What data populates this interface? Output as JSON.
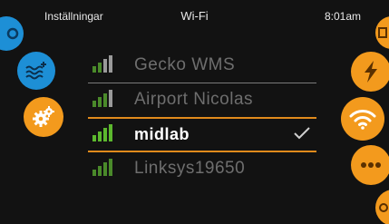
{
  "topbar": {
    "left": "Inställningar",
    "title": "Wi-Fi",
    "time": "8:01am"
  },
  "colors": {
    "accent": "#f39a1d",
    "signal": "#5cb82e",
    "water": "#1d8fd6",
    "background": "#121212"
  },
  "left_menu": [
    {
      "icon": "settings-icon-partial",
      "selected": false
    },
    {
      "icon": "water-heat-icon",
      "selected": false
    },
    {
      "icon": "gears-icon",
      "selected": true
    }
  ],
  "right_menu": [
    {
      "icon": "top-partial-icon",
      "selected": false
    },
    {
      "icon": "lightning-icon",
      "selected": false
    },
    {
      "icon": "wifi-icon",
      "selected": true
    },
    {
      "icon": "more-icon",
      "selected": false
    },
    {
      "icon": "bottom-partial-icon",
      "selected": false
    }
  ],
  "networks": [
    {
      "ssid": "Gecko WMS",
      "selected": false,
      "connected": false
    },
    {
      "ssid": "Airport Nicolas",
      "selected": false,
      "connected": false
    },
    {
      "ssid": "midlab",
      "selected": true,
      "connected": true
    },
    {
      "ssid": "Linksys19650",
      "selected": false,
      "connected": false
    }
  ]
}
